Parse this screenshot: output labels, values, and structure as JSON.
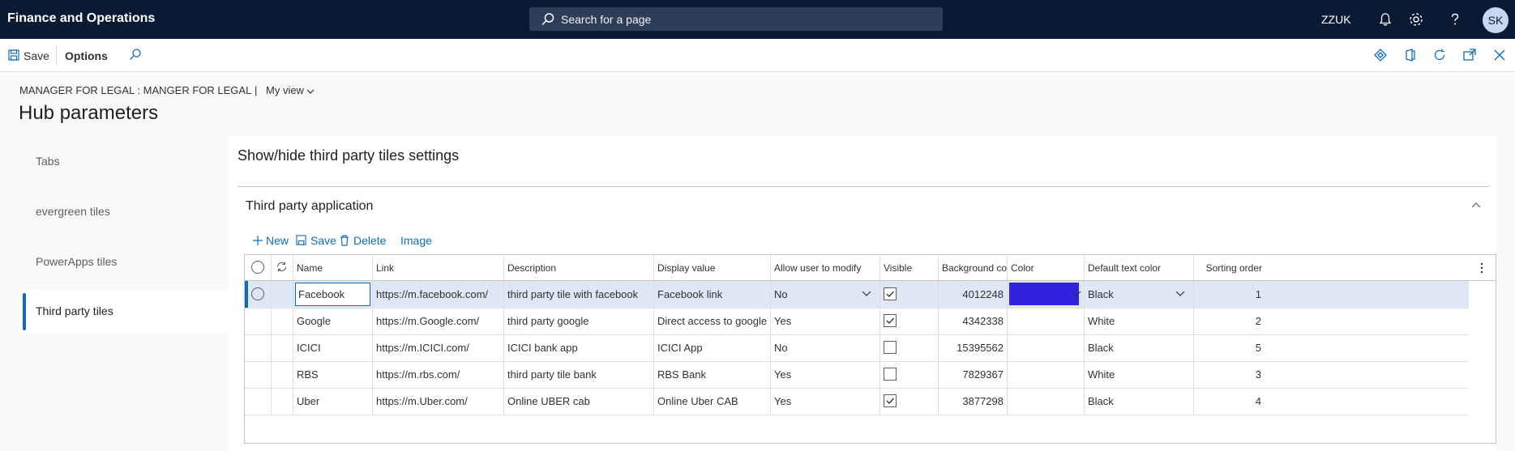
{
  "app": {
    "title": "Finance and Operations",
    "search_placeholder": "Search for a page",
    "company": "ZZUK",
    "user_initials": "SK"
  },
  "actionbar": {
    "save_label": "Save",
    "options_label": "Options"
  },
  "header": {
    "breadcrumb": "MANAGER FOR LEGAL : MANGER FOR LEGAL",
    "separator": "|",
    "view_label": "My view",
    "page_title": "Hub parameters"
  },
  "tabs": [
    {
      "label": "Tabs",
      "active": false
    },
    {
      "label": "evergreen tiles",
      "active": false
    },
    {
      "label": "PowerApps tiles",
      "active": false
    },
    {
      "label": "Third party tiles",
      "active": true
    }
  ],
  "panel": {
    "title": "Show/hide third party tiles settings",
    "section_title": "Third party application",
    "actions": {
      "new": "New",
      "save": "Save",
      "delete": "Delete",
      "image": "Image"
    }
  },
  "grid": {
    "columns": [
      "Name",
      "Link",
      "Description",
      "Display value",
      "Allow user to modify",
      "Visible",
      "Background co...",
      "Color",
      "Default text color",
      "Sorting order"
    ],
    "rows": [
      {
        "name": "Facebook",
        "link": "https://m.facebook.com/",
        "description": "third party tile with facebook",
        "display": "Facebook link",
        "allow": "No",
        "visible": true,
        "bg": "4012248",
        "color": "#3022e0",
        "text_color": "Black",
        "sort": "1",
        "selected": true
      },
      {
        "name": "Google",
        "link": "https://m.Google.com/",
        "description": "third party google",
        "display": "Direct access to google",
        "allow": "Yes",
        "visible": true,
        "bg": "4342338",
        "color": "",
        "text_color": "White",
        "sort": "2",
        "selected": false
      },
      {
        "name": "ICICI",
        "link": "https://m.ICICI.com/",
        "description": "ICICI bank app",
        "display": "ICICI App",
        "allow": "No",
        "visible": false,
        "bg": "15395562",
        "color": "",
        "text_color": "Black",
        "sort": "5",
        "selected": false
      },
      {
        "name": "RBS",
        "link": "https://m.rbs.com/",
        "description": "third party tile bank",
        "display": "RBS Bank",
        "allow": "Yes",
        "visible": false,
        "bg": "7829367",
        "color": "",
        "text_color": "White",
        "sort": "3",
        "selected": false
      },
      {
        "name": "Uber",
        "link": "https://m.Uber.com/",
        "description": "Online UBER cab",
        "display": "Online Uber CAB",
        "allow": "Yes",
        "visible": true,
        "bg": "3877298",
        "color": "",
        "text_color": "Black",
        "sort": "4",
        "selected": false
      }
    ]
  },
  "colors": {
    "nav_bg": "#0b1a33",
    "accent": "#0f6cbd",
    "selected_row": "#dde7f6"
  }
}
